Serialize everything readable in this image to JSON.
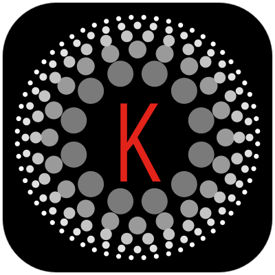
{
  "app_icon": {
    "icon": "dotted-circle-letter-k-icon",
    "colors": {
      "background": "#000000",
      "letter": "#e2231a",
      "dots_inner": "#7a7a7a",
      "dots_mid": "#9a9a9a",
      "dots_outer": "#c4c4c4",
      "dots_edge": "#ffffff"
    },
    "letter": "K"
  }
}
